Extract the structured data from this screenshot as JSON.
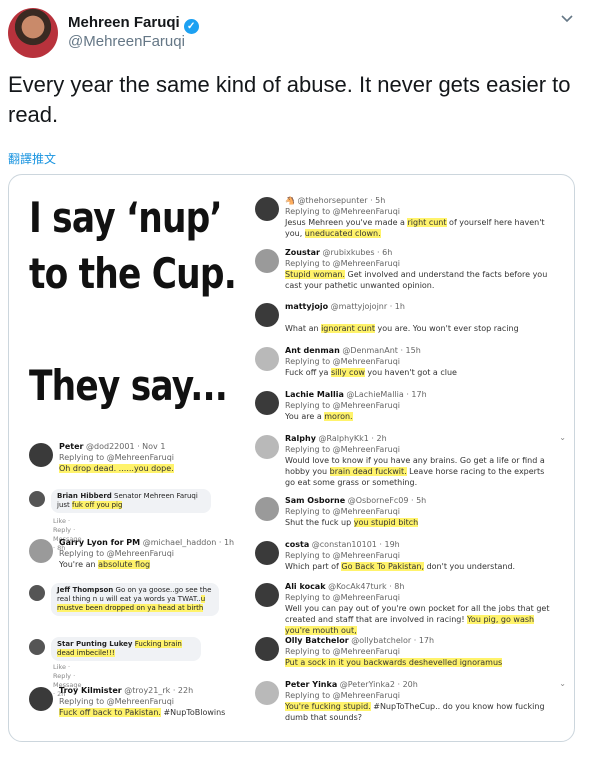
{
  "header": {
    "name": "Mehreen Faruqi",
    "handle": "@MehreenFaruqi",
    "verified_icon": "✓"
  },
  "tweet_text": "Every year the same kind of abuse. It never gets easier to read.",
  "translate_label": "翻譯推文",
  "image": {
    "headline1": "I say ‘nup’",
    "headline2": "to the Cup.",
    "headline3": "They say...",
    "left_items": [
      {
        "name": "Peter",
        "handle": "@dod22001 · Nov 1",
        "reply": "Replying to @MehreenFaruqi",
        "hl": "Oh drop dead. ......you dope.",
        "rest": ""
      },
      {
        "fb": true,
        "name": "Brian Hibberd",
        "pre": " Senator Mehreen Faruqi just ",
        "hl": "fuk off you pig",
        "meta": "Like · Reply · Message · 8h"
      },
      {
        "name": "Garry Lyon for PM",
        "handle": "@michael_haddon · 1h",
        "reply": "Replying to @MehreenFaruqi",
        "pre": "You're an ",
        "hl": "absolute flog",
        "rest": ""
      },
      {
        "fb": true,
        "name": "Jeff Thompson",
        "pre": " Go on ya goose..go see the real thing n u will eat ya words ya TWAT..",
        "hl": "u mustve been dropped on ya head at birth",
        "meta": ""
      },
      {
        "fb": true,
        "name": "Star Punting Lukey",
        "pre": " ",
        "hl": "Fucking brain dead imbecile!!!",
        "meta": "Like · Reply · Message · 2h"
      },
      {
        "name": "Troy Kilmister",
        "handle": "@troy21_rk · 22h",
        "reply": "Replying to @MehreenFaruqi",
        "hl": "Fuck off back to Pakistan.",
        "rest": " #NupToBlowins"
      }
    ],
    "right_items": [
      {
        "name": "",
        "handle": "@thehorsepunter · 5h",
        "reply": "Replying to @MehreenFaruqi",
        "pre": "Jesus Mehreen you've made a ",
        "hl": "right cunt",
        "mid": " of yourself here haven't you, ",
        "hl2": "uneducated clown."
      },
      {
        "name": "Zoustar",
        "handle": "@rubixkubes · 6h",
        "reply": "Replying to @MehreenFaruqi",
        "hl": "Stupid woman.",
        "rest": " Get involved and understand the facts before you cast your pathetic unwanted opinion."
      },
      {
        "name": "mattyjojo",
        "handle": "@mattyjojojnr · 1h",
        "reply": "",
        "pre": "What an ",
        "hl": "ignorant cunt",
        "rest": " you are. You won't ever stop racing"
      },
      {
        "name": "Ant denman",
        "handle": "@DenmanAnt · 15h",
        "reply": "Replying to @MehreenFaruqi",
        "pre": "Fuck off ya ",
        "hl": "silly cow",
        "rest": " you haven't got a clue"
      },
      {
        "name": "Lachie Mallia",
        "handle": "@LachieMallia · 17h",
        "reply": "Replying to @MehreenFaruqi",
        "pre": "You are a ",
        "hl": "moron.",
        "rest": ""
      },
      {
        "name": "Ralphy",
        "handle": "@RalphyKk1 · 2h",
        "reply": "Replying to @MehreenFaruqi",
        "pre": "Would love to know if you have any brains. Go get a life or find a hobby you ",
        "hl": "brain dead fuckwit.",
        "rest": " Leave horse racing to the experts go eat some grass or something."
      },
      {
        "name": "Sam Osborne",
        "handle": "@OsborneFc09 · 5h",
        "reply": "Replying to @MehreenFaruqi",
        "pre": "Shut the fuck up ",
        "hl": "you stupid bitch",
        "rest": ""
      },
      {
        "name": "costa",
        "handle": "@constan10101 · 19h",
        "reply": "Replying to @MehreenFaruqi",
        "pre": "Which part of ",
        "hl": "Go Back To Pakistan,",
        "rest": " don't you understand."
      },
      {
        "name": "Ali kocak",
        "handle": "@KocAk47turk · 8h",
        "reply": "Replying to @MehreenFaruqi",
        "pre": "Well you can pay  out of you're own pocket for all the jobs that get created and staff that are involved in racing! ",
        "hl": "You pig, go wash you're mouth out,",
        "rest": ""
      },
      {
        "name": "Olly Batchelor",
        "handle": "@ollybatchelor · 17h",
        "reply": "Replying to @MehreenFaruqi",
        "hl": "Put a sock in it you backwards deshevelled ignoramus",
        "rest": ""
      },
      {
        "name": "Peter Yinka",
        "handle": "@PeterYinka2 · 20h",
        "reply": "Replying to @MehreenFaruqi",
        "hl": "You're fucking stupid.",
        "rest": " #NupToTheCup.. do you know how fucking dumb that sounds?"
      }
    ]
  }
}
